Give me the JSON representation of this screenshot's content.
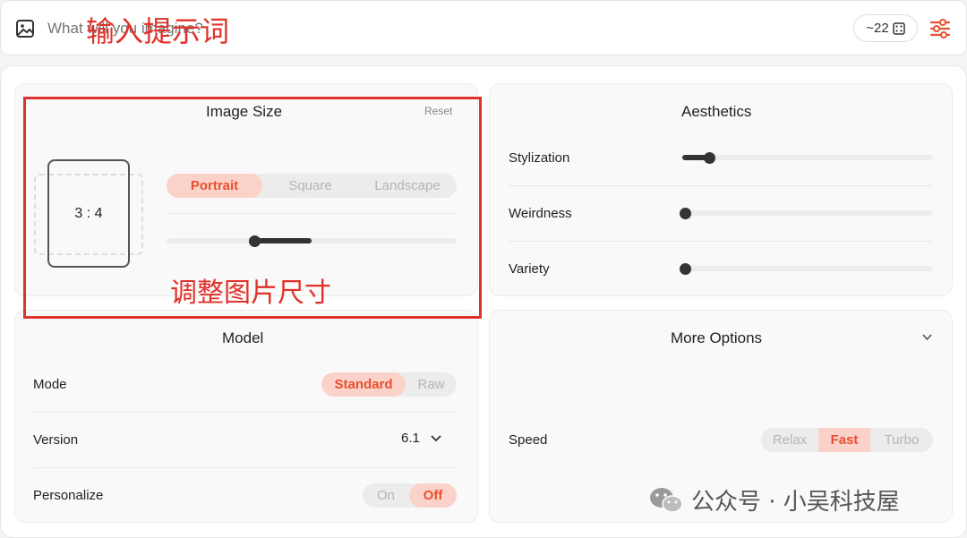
{
  "prompt": {
    "placeholder": "What will you imagine?",
    "annotation": "输入提示词",
    "count": "~22"
  },
  "image_size": {
    "title": "Image Size",
    "reset": "Reset",
    "ratio": "3 : 4",
    "orientations": [
      "Portrait",
      "Square",
      "Landscape"
    ],
    "selected": "Portrait",
    "annotation": "调整图片尺寸"
  },
  "aesthetics": {
    "title": "Aesthetics",
    "sliders": [
      {
        "label": "Stylization",
        "value": 0.1
      },
      {
        "label": "Weirdness",
        "value": 0
      },
      {
        "label": "Variety",
        "value": 0
      }
    ]
  },
  "model": {
    "title": "Model",
    "mode_label": "Mode",
    "mode_options": [
      "Standard",
      "Raw"
    ],
    "mode_selected": "Standard",
    "version_label": "Version",
    "version_value": "6.1",
    "personalize_label": "Personalize",
    "personalize_options": [
      "On",
      "Off"
    ],
    "personalize_selected": "Off"
  },
  "more_options": {
    "title": "More Options",
    "speed_label": "Speed",
    "speed_options": [
      "Relax",
      "Fast",
      "Turbo"
    ],
    "speed_selected": "Fast"
  },
  "watermark": "公众号 · 小吴科技屋",
  "colors": {
    "accent": "#e8502f",
    "accent_bg": "#fbd2ca",
    "annotation": "#e0312a"
  }
}
